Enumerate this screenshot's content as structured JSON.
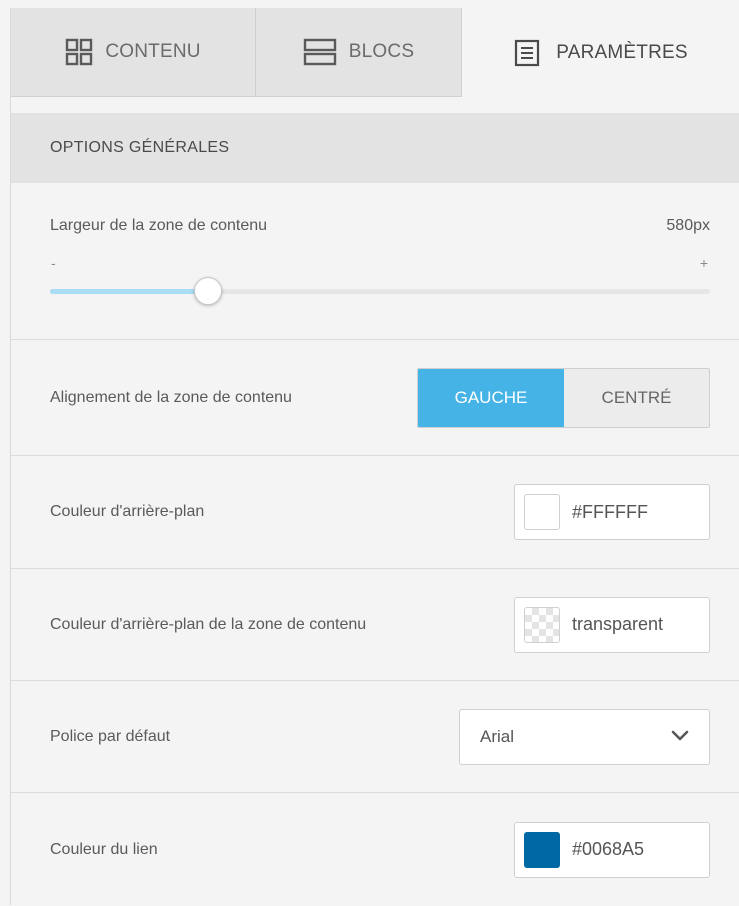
{
  "tabs": [
    {
      "label": "CONTENU",
      "icon": "grid-icon"
    },
    {
      "label": "BLOCS",
      "icon": "blocks-icon"
    },
    {
      "label": "PARAMÈTRES",
      "icon": "settings-doc-icon",
      "active": true
    }
  ],
  "section": {
    "title": "OPTIONS GÉNÉRALES"
  },
  "width_setting": {
    "label": "Largeur de la zone de contenu",
    "value": "580px",
    "min_label": "-",
    "max_label": "+",
    "slider_fraction": 0.24
  },
  "alignment": {
    "label": "Alignement de la zone de contenu",
    "options": [
      "GAUCHE",
      "CENTRÉ"
    ],
    "selected": "GAUCHE"
  },
  "background_color": {
    "label": "Couleur d'arrière-plan",
    "value": "#FFFFFF",
    "swatch": "#FFFFFF"
  },
  "content_background_color": {
    "label": "Couleur d'arrière-plan de la zone de contenu",
    "value": "transparent"
  },
  "default_font": {
    "label": "Police par défaut",
    "value": "Arial"
  },
  "link_color": {
    "label": "Couleur du lien",
    "value": "#0068A5",
    "swatch": "#0068A5"
  },
  "colors": {
    "accent": "#46B3E6",
    "slider_fill": "#A9DCF5"
  }
}
